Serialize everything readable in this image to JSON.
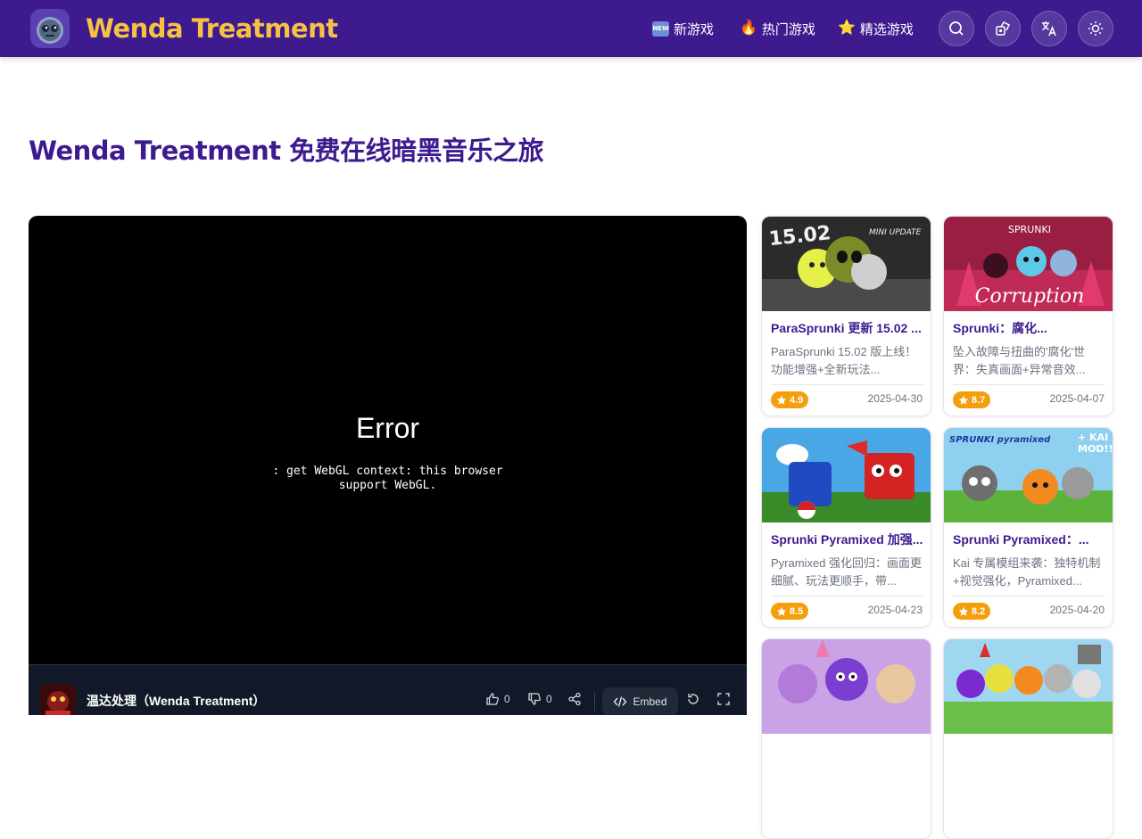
{
  "header": {
    "brand": "Wenda Treatment",
    "nav": [
      {
        "label": "新游戏",
        "icon": "new-badge",
        "badge_text": "NEW"
      },
      {
        "label": "热门游戏",
        "icon": "fire-emoji",
        "glyph": "🔥"
      },
      {
        "label": "精选游戏",
        "icon": "star-emoji",
        "glyph": "⭐"
      }
    ],
    "buttons": [
      "search-icon",
      "random-game-icon",
      "translate-icon",
      "sun-icon"
    ]
  },
  "page_title": "Wenda Treatment 免费在线暗黑音乐之旅",
  "player": {
    "error_title": "Error",
    "error_line1": ": get WebGL context: this browser",
    "error_line2": "support WebGL.",
    "game_name": "温达处理（Wenda Treatment）",
    "likes": "0",
    "dislikes": "0",
    "embed_label": "Embed"
  },
  "cards": [
    {
      "title": "ParaSprunki 更新 15.02 ...",
      "desc": "ParaSprunki 15.02 版上线！功能增强+全新玩法...",
      "rating": "4.9",
      "date": "2025-04-30",
      "image_text": "15.02 MINI UPDATE"
    },
    {
      "title": "Sprunki：腐化...",
      "desc": "坠入故障与扭曲的'腐化'世界：失真画面+异常音效...",
      "rating": "8.7",
      "date": "2025-04-07",
      "image_text": "SPRUNKI Corruption"
    },
    {
      "title": "Sprunki Pyramixed 加强...",
      "desc": "Pyramixed 强化回归：画面更细腻、玩法更顺手，带...",
      "rating": "8.5",
      "date": "2025-04-23",
      "image_text": ""
    },
    {
      "title": "Sprunki Pyramixed：...",
      "desc": "Kai 专属模组来袭：独特机制+视觉强化，Pyramixed...",
      "rating": "8.2",
      "date": "2025-04-20",
      "image_text": "SPRUNKI pyramixed + KAI MOD!!"
    },
    {
      "title": "",
      "desc": "",
      "rating": "",
      "date": "",
      "image_text": ""
    },
    {
      "title": "",
      "desc": "",
      "rating": "",
      "date": "",
      "image_text": ""
    }
  ]
}
